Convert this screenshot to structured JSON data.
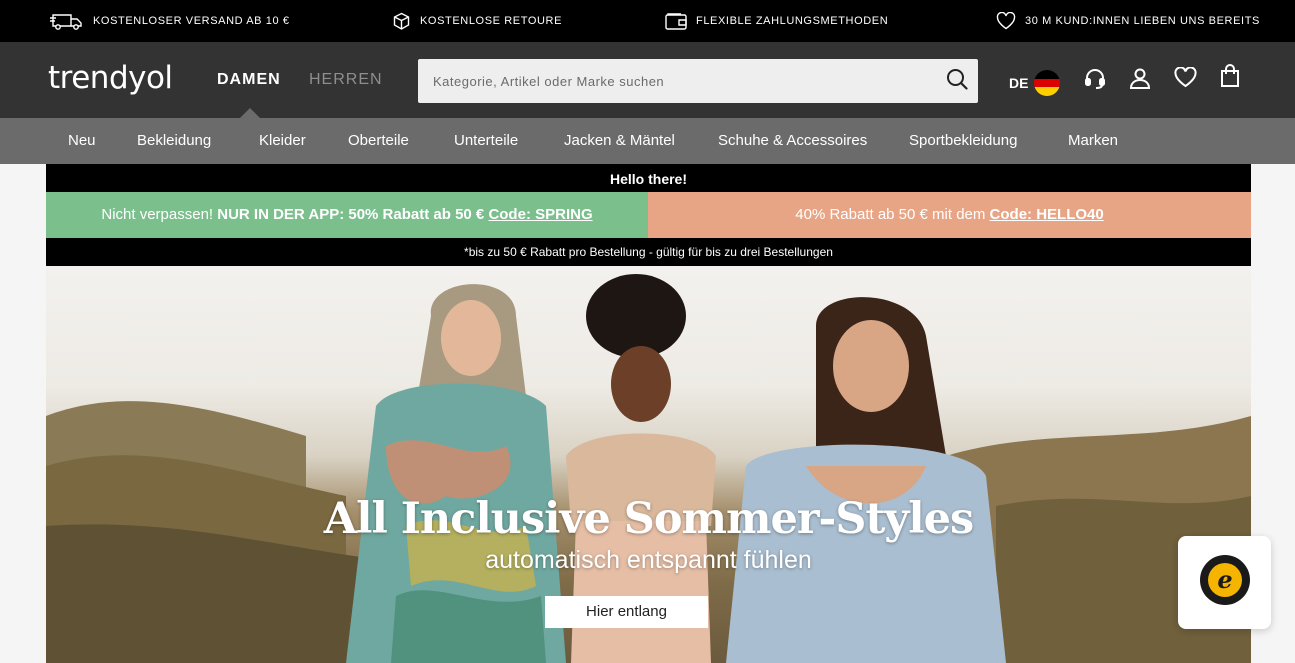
{
  "infobar": {
    "items": [
      {
        "icon": "truck-icon",
        "label": "KOSTENLOSER VERSAND AB 10 €"
      },
      {
        "icon": "return-box-icon",
        "label": "KOSTENLOSE RETOURE"
      },
      {
        "icon": "wallet-icon",
        "label": "FLEXIBLE ZAHLUNGSMETHODEN"
      },
      {
        "icon": "heart-icon",
        "label": "30 M KUND:INNEN LIEBEN UNS BEREITS"
      }
    ]
  },
  "header": {
    "logo": "trendyol",
    "gender_tabs": [
      {
        "label": "DAMEN",
        "active": true
      },
      {
        "label": "HERREN",
        "active": false
      }
    ],
    "search": {
      "placeholder": "Kategorie, Artikel oder Marke suchen",
      "value": ""
    },
    "language": "DE",
    "icons": [
      "headset-icon",
      "user-icon",
      "heart-icon",
      "shopping-bag-icon"
    ]
  },
  "categories": [
    "Neu",
    "Bekleidung",
    "Kleider",
    "Oberteile",
    "Unterteile",
    "Jacken & Mäntel",
    "Schuhe & Accessoires",
    "Sportbekleidung",
    "Marken"
  ],
  "banner": {
    "hello": "Hello there!",
    "promo_left": {
      "prefix": "Nicht verpassen! ",
      "bold": "NUR IN DER APP: 50% Rabatt ab 50 € ",
      "code": "Code: SPRING"
    },
    "promo_right": {
      "prefix": "40% Rabatt ab 50 € mit dem ",
      "code": "Code: HELLO40"
    },
    "note": "*bis zu 50 € Rabatt pro Bestellung - gültig für bis zu drei Bestellungen",
    "headline": "All Inclusive Sommer-Styles",
    "subline": "automatisch entspannt fühlen",
    "cta": "Hier entlang"
  },
  "colors": {
    "topbar": "#000000",
    "header": "#333333",
    "catnav": "#6b6b6b",
    "promo_green": "#7bbf8d",
    "promo_orange": "#e8a585"
  }
}
